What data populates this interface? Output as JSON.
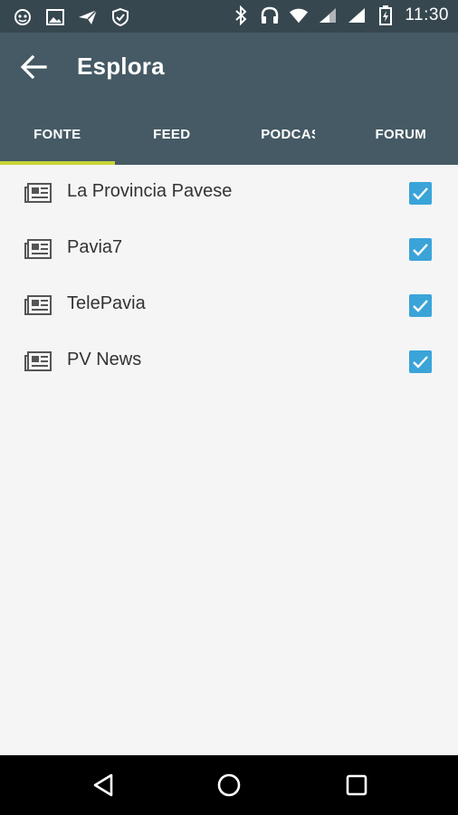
{
  "status_bar": {
    "left_icons": [
      "ghost-icon",
      "image-icon",
      "send-icon",
      "shield-icon"
    ],
    "right_icons": [
      "bluetooth-icon",
      "headset-icon",
      "wifi-icon",
      "signal-icon",
      "signal-icon",
      "battery-icon"
    ],
    "time": "11:30"
  },
  "app_bar": {
    "title": "Esplora",
    "back_icon": "arrow-left-icon",
    "background": "#455a64"
  },
  "tabs": [
    {
      "label": "FONTE",
      "active": true
    },
    {
      "label": "FEED",
      "active": false
    },
    {
      "label": "PODCAST",
      "active": false
    },
    {
      "label": "FORUM",
      "active": false
    }
  ],
  "tab_indicator_color": "#c9d338",
  "sources": [
    {
      "label": "La Provincia Pavese",
      "icon": "newspaper-icon",
      "checked": true
    },
    {
      "label": "Pavia7",
      "icon": "newspaper-icon",
      "checked": true
    },
    {
      "label": "TelePavia",
      "icon": "newspaper-icon",
      "checked": true
    },
    {
      "label": "PV News",
      "icon": "newspaper-icon",
      "checked": true
    }
  ],
  "checkbox_color": "#3aa4d9",
  "nav_bar": {
    "buttons": [
      "back-triangle-icon",
      "home-circle-icon",
      "recents-square-icon"
    ]
  }
}
